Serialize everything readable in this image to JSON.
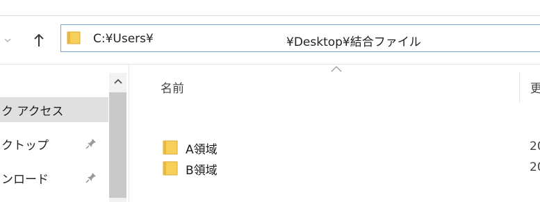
{
  "address_bar": {
    "segments": [
      "C:¥Users¥",
      "¥Desktop¥結合ファイル"
    ]
  },
  "navigation_pane": {
    "items": [
      {
        "label": "ク アクセス",
        "selected": true,
        "pinned": false
      },
      {
        "label": "クトップ",
        "selected": false,
        "pinned": true
      },
      {
        "label": "ンロード",
        "selected": false,
        "pinned": true
      }
    ]
  },
  "file_list": {
    "columns": {
      "name": "名前",
      "date_modified": "更"
    },
    "sort_indicator": "ascending",
    "rows": [
      {
        "name": "A領域",
        "date_modified": "20"
      },
      {
        "name": "B領域",
        "date_modified": "20"
      }
    ]
  },
  "colors": {
    "folder_yellow": "#f7cf5b",
    "address_border": "#7aa7d6",
    "selected_background": "#e0e0e0"
  },
  "icons": [
    "recent-locations-icon",
    "up-arrow-icon",
    "folder-icon",
    "pin-icon",
    "sort-ascending-icon",
    "scroll-up-icon"
  ]
}
